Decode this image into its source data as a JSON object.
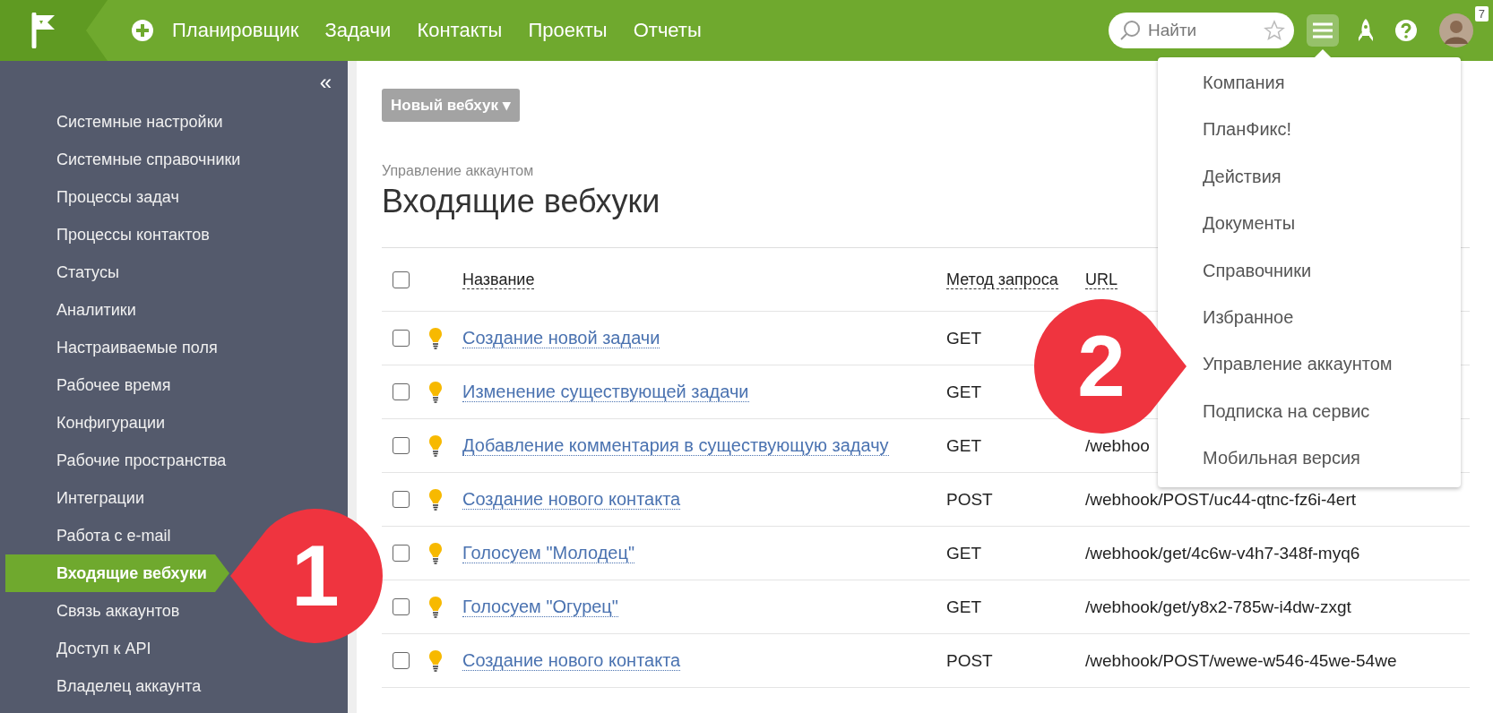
{
  "topbar": {
    "nav": [
      "Планировщик",
      "Задачи",
      "Контакты",
      "Проекты",
      "Отчеты"
    ],
    "search": {
      "placeholder": "Найти"
    },
    "notification_count": "7"
  },
  "sidebar": {
    "collapse": "«",
    "items": [
      {
        "label": "Системные настройки",
        "selected": false
      },
      {
        "label": "Системные справочники",
        "selected": false
      },
      {
        "label": "Процессы задач",
        "selected": false
      },
      {
        "label": "Процессы контактов",
        "selected": false
      },
      {
        "label": "Статусы",
        "selected": false
      },
      {
        "label": "Аналитики",
        "selected": false
      },
      {
        "label": "Настраиваемые поля",
        "selected": false
      },
      {
        "label": "Рабочее время",
        "selected": false
      },
      {
        "label": "Конфигурации",
        "selected": false
      },
      {
        "label": "Рабочие пространства",
        "selected": false
      },
      {
        "label": "Интеграции",
        "selected": false
      },
      {
        "label": "Работа с e-mail",
        "selected": false
      },
      {
        "label": "Входящие вебхуки",
        "selected": true
      },
      {
        "label": "Связь аккаунтов",
        "selected": false
      },
      {
        "label": "Доступ к API",
        "selected": false
      },
      {
        "label": "Владелец аккаунта",
        "selected": false
      }
    ]
  },
  "new_button": "Новый вебхук ▾",
  "breadcrumb": "Управление аккаунтом",
  "title": "Входящие вебхуки",
  "table": {
    "all_checked": false,
    "columns": [
      "Название",
      "Метод запроса",
      "URL"
    ],
    "rows": [
      {
        "checked": false,
        "name": "Создание новой задачи",
        "method": "GET"
      },
      {
        "checked": false,
        "name": "Изменение существующей задачи",
        "method": "GET"
      },
      {
        "checked": false,
        "name": "Добавление комментария в существующую задачу",
        "method": "GET",
        "url": "/webhoo"
      },
      {
        "checked": false,
        "name": "Создание нового контакта",
        "method": "POST",
        "url": "/webhook/POST/uc44-qtnc-fz6i-4ert"
      },
      {
        "checked": false,
        "name": "Голосуем \"Молодец\"",
        "method": "GET",
        "url": "/webhook/get/4c6w-v4h7-348f-myq6"
      },
      {
        "checked": false,
        "name": "Голосуем \"Огурец\"",
        "method": "GET",
        "url": "/webhook/get/y8x2-785w-i4dw-zxgt"
      },
      {
        "checked": false,
        "name": "Создание нового контакта",
        "method": "POST",
        "url": "/webhook/POST/wewe-w546-45we-54we"
      }
    ]
  },
  "menu": {
    "open": true,
    "items": [
      "Компания",
      "ПланФикс!",
      "Действия",
      "Документы",
      "Справочники",
      "Избранное",
      "Управление аккаунтом",
      "Подписка на сервис",
      "Мобильная версия"
    ]
  },
  "callouts": [
    {
      "number": "1",
      "kind": "left"
    },
    {
      "number": "2",
      "kind": "right"
    }
  ]
}
